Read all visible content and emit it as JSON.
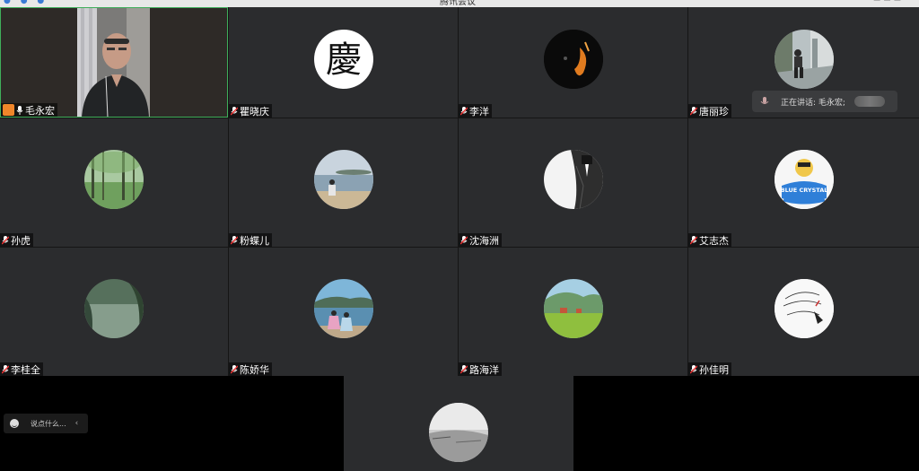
{
  "window": {
    "title": "腾讯会议"
  },
  "speaking": {
    "label": "正在讲话: 毛永宏;"
  },
  "chat": {
    "placeholder": "说点什么..."
  },
  "participants": [
    {
      "name": "毛永宏"
    },
    {
      "name": "瞿晓庆"
    },
    {
      "name": "李洋"
    },
    {
      "name": "唐丽珍"
    },
    {
      "name": "孙虎"
    },
    {
      "name": "粉蝶儿"
    },
    {
      "name": "沈海洲"
    },
    {
      "name": "艾志杰"
    },
    {
      "name": "李桂全"
    },
    {
      "name": "陈娇华"
    },
    {
      "name": "路海洋"
    },
    {
      "name": "孙佳明"
    }
  ],
  "avatar_text": {
    "qing": "慶",
    "blue_crystal": "BLUE CRYSTAL"
  }
}
